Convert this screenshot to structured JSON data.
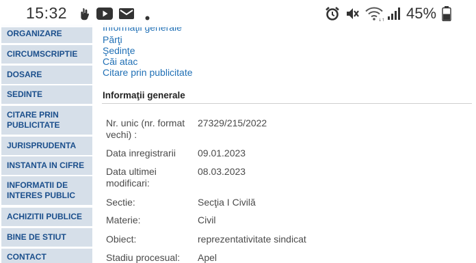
{
  "status_bar": {
    "time": "15:32",
    "battery": "45%",
    "left_icons": [
      "hand-icon",
      "youtube-icon",
      "mail-icon",
      "dot-icon"
    ],
    "right_icons": [
      "alarm-icon",
      "mute-icon",
      "wifi-icon",
      "signal-icon",
      "battery-icon"
    ]
  },
  "sidebar": {
    "items": [
      "ORGANIZARE",
      "CIRCUMSCRIPTIE",
      "DOSARE",
      "SEDINTE",
      "CITARE PRIN\nPUBLICITATE",
      "JURISPRUDENTA",
      "INSTANTA IN CIFRE",
      "INFORMATII DE\nINTERES PUBLIC",
      "ACHIZITII PUBLICE",
      "BINE DE STIUT",
      "CONTACT"
    ]
  },
  "doc_links": [
    "Informaţii generale",
    "Părţi",
    "Şedinţe",
    "Căi atac",
    "Citare prin publicitate"
  ],
  "section": {
    "title": "Informaţii generale"
  },
  "info_rows": [
    {
      "label": "Nr. unic (nr. format vechi) :",
      "value": "27329/215/2022"
    },
    {
      "label": "Data inregistrarii",
      "value": "09.01.2023"
    },
    {
      "label": "Data ultimei modificari:",
      "value": "08.03.2023"
    },
    {
      "label": "Sectie:",
      "value": "Secţia I Civilă"
    },
    {
      "label": "Materie:",
      "value": "Civil"
    },
    {
      "label": "Obiect:",
      "value": "reprezentativitate sindicat"
    },
    {
      "label": "Stadiu procesual:",
      "value": "Apel"
    }
  ]
}
